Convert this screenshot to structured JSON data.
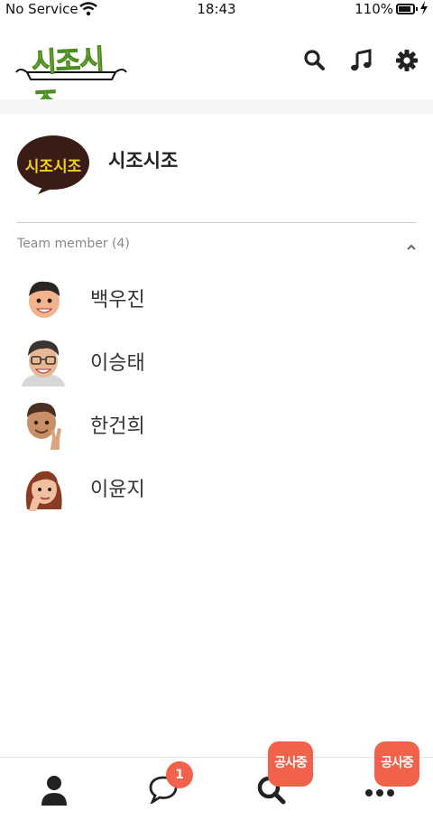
{
  "status_bar": {
    "carrier": "No Service",
    "time": "18:43",
    "battery_percent": "110%"
  },
  "header": {
    "logo_text": "시조시조",
    "icons": [
      "search-icon",
      "music-note-icon",
      "gear-icon"
    ]
  },
  "team": {
    "logo_text": "시조시조",
    "name": "시조시조"
  },
  "members_section": {
    "label": "Team member",
    "count": "(4)",
    "expanded": true
  },
  "members": [
    {
      "name": "백우진",
      "avatar": "avatar-boy-smiling"
    },
    {
      "name": "이승태",
      "avatar": "avatar-man-glasses"
    },
    {
      "name": "한건희",
      "avatar": "avatar-man-peace-sign"
    },
    {
      "name": "이윤지",
      "avatar": "avatar-woman-thinking"
    }
  ],
  "bottom_nav": {
    "items": [
      {
        "icon": "person-icon"
      },
      {
        "icon": "chat-bubble-icon",
        "badge": "1"
      },
      {
        "icon": "search-icon",
        "tag": "공사중"
      },
      {
        "icon": "more-dots-icon",
        "tag": "공사중"
      }
    ]
  },
  "colors": {
    "accent": "#f2624a",
    "logo_green": "#9ee04a",
    "team_logo_bg": "#3a1c16",
    "team_logo_text": "#f3d21a"
  }
}
